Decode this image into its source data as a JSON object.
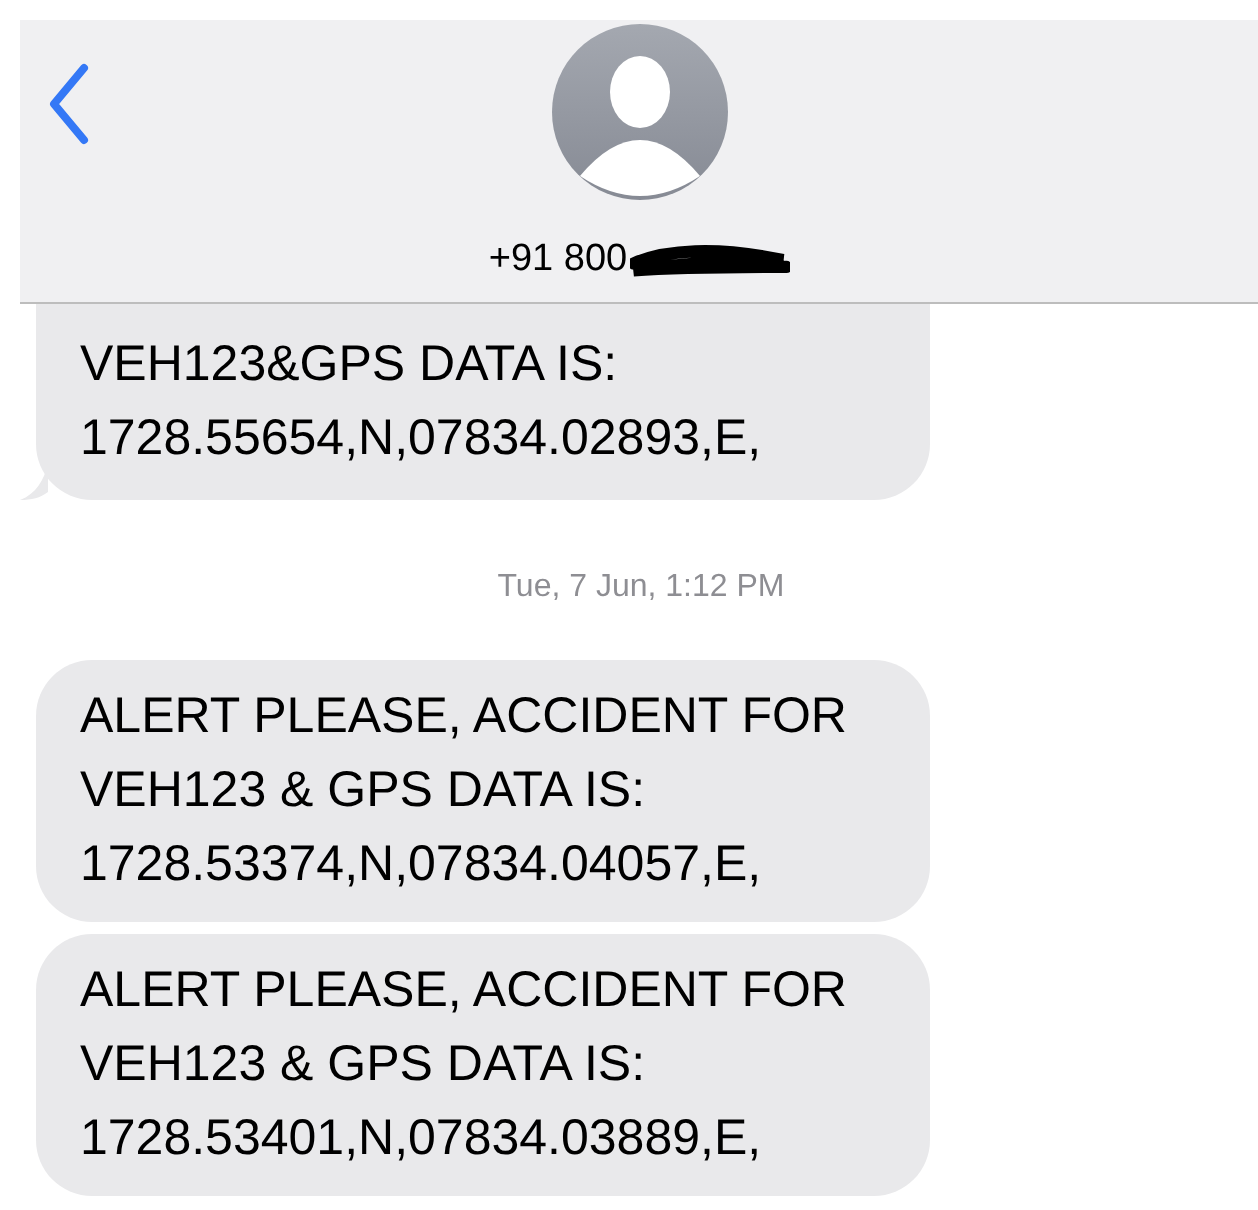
{
  "header": {
    "contact": "+91 800"
  },
  "messages": [
    {
      "kind": "bubble",
      "lines": [
        "VEH123&GPS DATA IS:",
        "1728.55654,N,07834.02893,E,"
      ],
      "tail": true,
      "cut_top": true
    },
    {
      "kind": "timestamp",
      "text": "Tue, 7 Jun, 1:12 PM"
    },
    {
      "kind": "bubble",
      "lines": [
        "ALERT PLEASE, ACCIDENT FOR",
        "VEH123 & GPS DATA IS:",
        "1728.53374,N,07834.04057,E,"
      ]
    },
    {
      "kind": "bubble",
      "lines": [
        "ALERT PLEASE, ACCIDENT FOR",
        "VEH123 & GPS DATA IS:",
        "1728.53401,N,07834.03889,E,"
      ]
    }
  ]
}
